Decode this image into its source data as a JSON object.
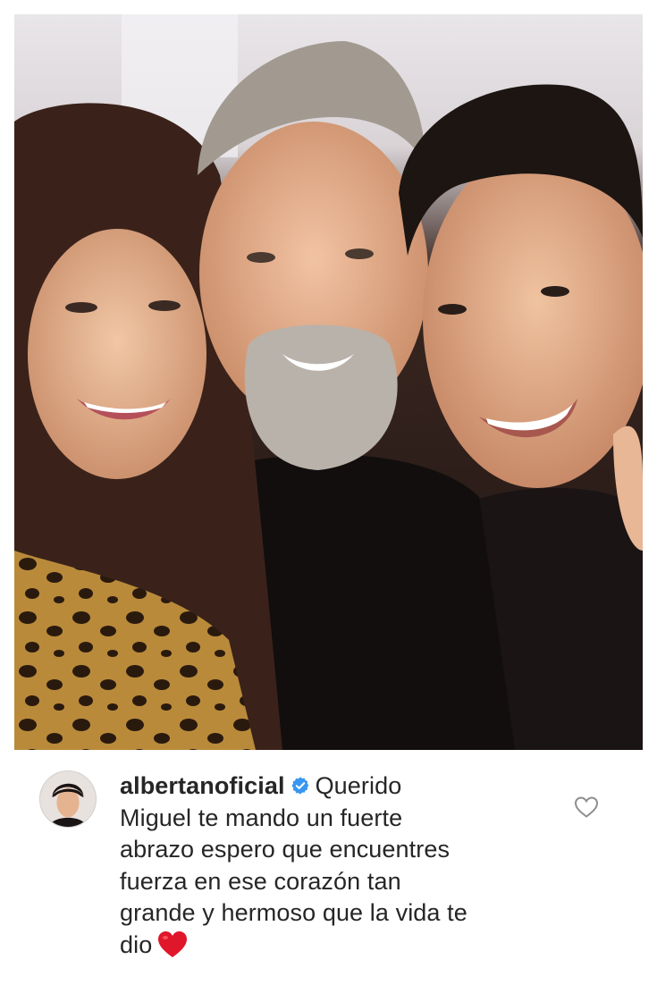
{
  "post": {
    "photo_icon": "group-selfie-photo"
  },
  "comment": {
    "username": "albertanoficial",
    "verified_icon": "verified-badge-icon",
    "text_lines": [
      "Querido",
      "Miguel te mando un fuerte",
      "abrazo espero que encuentres",
      "fuerza en ese corazón tan",
      "grande y hermoso que la vida te",
      "dio"
    ],
    "emoji_icon": "red-heart-emoji",
    "like_icon": "heart-outline-icon",
    "colors": {
      "text": "#262626",
      "verified": "#3897f0",
      "heart_emoji": "#e0162b",
      "like_outline": "#8e8e8e"
    }
  }
}
